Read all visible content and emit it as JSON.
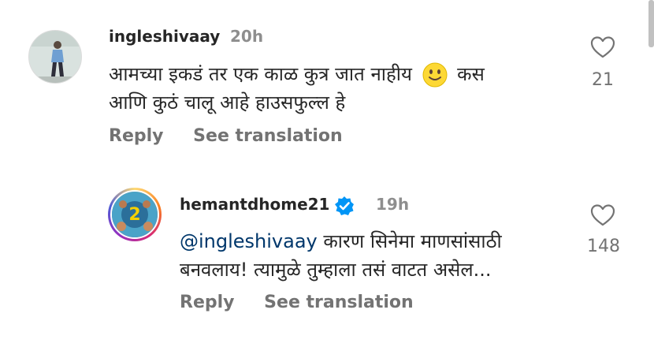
{
  "comments": [
    {
      "username": "ingleshivaay",
      "time": "20h",
      "text_line1_a": "आमच्या इकडं तर एक काळ कुत्र जात नाहीय",
      "emoji": "slightly-smiling-face",
      "text_line1_b": "कस",
      "text_line2": "आणि कुठं चालू आहे हाउसफुल्ल हे",
      "likes": "21",
      "reply_label": "Reply",
      "translate_label": "See translation"
    },
    {
      "username": "hemantdhome21",
      "verified": true,
      "time": "19h",
      "mention": "@ingleshivaay",
      "text_line1": " कारण सिनेमा माणसांसाठी",
      "text_line2": "बनवलाय! त्यामुळे तुम्हाला तसं वाटत असेल...",
      "likes": "148",
      "reply_label": "Reply",
      "translate_label": "See translation"
    }
  ],
  "colors": {
    "text": "#262626",
    "secondary": "#737373",
    "mention": "#00376b",
    "verified": "#0095f6"
  }
}
